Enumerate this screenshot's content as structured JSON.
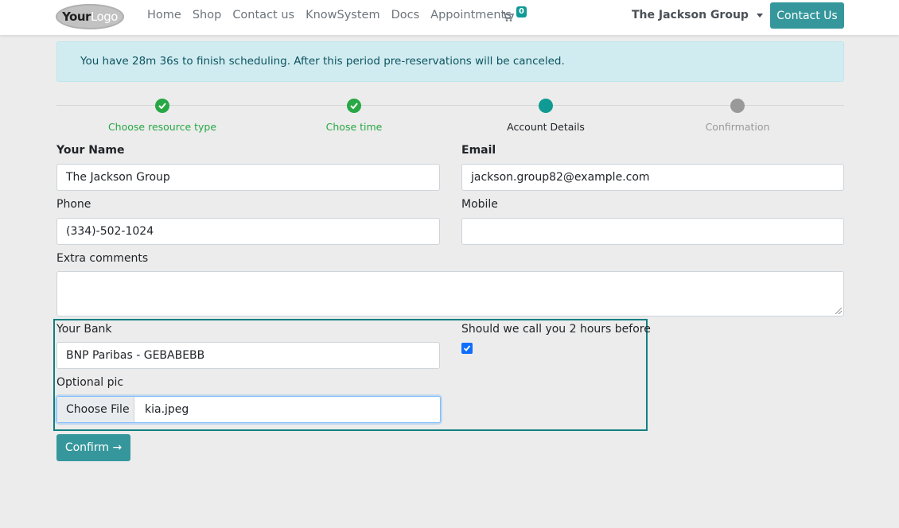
{
  "nav": {
    "logo_part1": "Your",
    "logo_part2": "Logo",
    "links": [
      "Home",
      "Shop",
      "Contact us",
      "KnowSystem",
      "Docs",
      "Appointments"
    ],
    "cart_count": "0",
    "company": "The Jackson Group",
    "contact_button": "Contact Us"
  },
  "alert": {
    "text": "You have 28m 36s to finish scheduling. After this period pre-reservations will be canceled."
  },
  "steps": [
    {
      "label": "Choose resource type",
      "state": "done"
    },
    {
      "label": "Chose time",
      "state": "done"
    },
    {
      "label": "Account Details",
      "state": "current"
    },
    {
      "label": "Confirmation",
      "state": "future"
    }
  ],
  "form": {
    "name_label": "Your Name",
    "name_value": "The Jackson Group",
    "email_label": "Email",
    "email_value": "jackson.group82@example.com",
    "phone_label": "Phone",
    "phone_value": "(334)-502-1024",
    "mobile_label": "Mobile",
    "mobile_value": "",
    "comments_label": "Extra comments",
    "comments_value": "",
    "bank_label": "Your Bank",
    "bank_value": "BNP Paribas - GEBABEBB",
    "call_label": "Should we call you 2 hours before",
    "call_checked": true,
    "pic_label": "Optional pic",
    "file_button": "Choose File",
    "file_name": "kia.jpeg",
    "confirm_button": "Confirm →"
  },
  "colors": {
    "accent": "#35979c",
    "done": "#28a745",
    "current": "#0f9a94",
    "future": "#999999"
  }
}
